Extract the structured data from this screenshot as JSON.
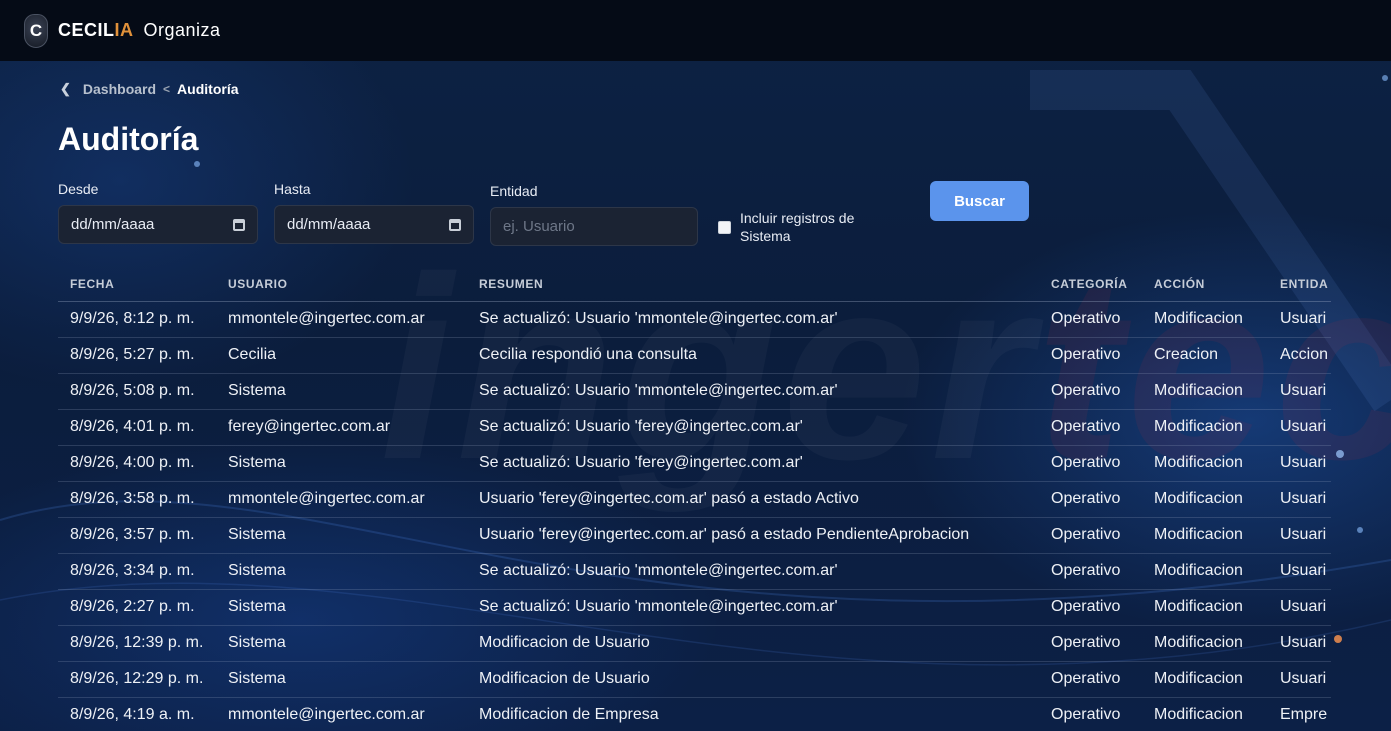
{
  "header": {
    "logo_letter": "C",
    "brand_main": "CECIL",
    "brand_accent": "IA",
    "brand_sub": "Organiza"
  },
  "breadcrumb": {
    "back_icon": "chevron-left-icon",
    "parent": "Dashboard",
    "separator": "<",
    "current": "Auditoría"
  },
  "page_title": "Auditoría",
  "filters": {
    "desde_label": "Desde",
    "desde_value": "dd/mm/aaaa",
    "hasta_label": "Hasta",
    "hasta_value": "dd/mm/aaaa",
    "entidad_label": "Entidad",
    "entidad_placeholder": "ej. Usuario",
    "include_system_label": "Incluir registros de Sistema",
    "include_system_checked": false,
    "search_button": "Buscar"
  },
  "table": {
    "columns": [
      "FECHA",
      "USUARIO",
      "RESUMEN",
      "CATEGORÍA",
      "ACCIÓN",
      "ENTIDA"
    ],
    "rows": [
      [
        "9/9/26, 8:12 p. m.",
        "mmontele@ingertec.com.ar",
        "Se actualizó: Usuario 'mmontele@ingertec.com.ar'",
        "Operativo",
        "Modificacion",
        "Usuari"
      ],
      [
        "8/9/26, 5:27 p. m.",
        "Cecilia",
        "Cecilia respondió una consulta",
        "Operativo",
        "Creacion",
        "Accion"
      ],
      [
        "8/9/26, 5:08 p. m.",
        "Sistema",
        "Se actualizó: Usuario 'mmontele@ingertec.com.ar'",
        "Operativo",
        "Modificacion",
        "Usuari"
      ],
      [
        "8/9/26, 4:01 p. m.",
        "ferey@ingertec.com.ar",
        "Se actualizó: Usuario 'ferey@ingertec.com.ar'",
        "Operativo",
        "Modificacion",
        "Usuari"
      ],
      [
        "8/9/26, 4:00 p. m.",
        "Sistema",
        "Se actualizó: Usuario 'ferey@ingertec.com.ar'",
        "Operativo",
        "Modificacion",
        "Usuari"
      ],
      [
        "8/9/26, 3:58 p. m.",
        "mmontele@ingertec.com.ar",
        "Usuario 'ferey@ingertec.com.ar' pasó a estado Activo",
        "Operativo",
        "Modificacion",
        "Usuari"
      ],
      [
        "8/9/26, 3:57 p. m.",
        "Sistema",
        "Usuario 'ferey@ingertec.com.ar' pasó a estado PendienteAprobacion",
        "Operativo",
        "Modificacion",
        "Usuari"
      ],
      [
        "8/9/26, 3:34 p. m.",
        "Sistema",
        "Se actualizó: Usuario 'mmontele@ingertec.com.ar'",
        "Operativo",
        "Modificacion",
        "Usuari"
      ],
      [
        "8/9/26, 2:27 p. m.",
        "Sistema",
        "Se actualizó: Usuario 'mmontele@ingertec.com.ar'",
        "Operativo",
        "Modificacion",
        "Usuari"
      ],
      [
        "8/9/26, 12:39 p. m.",
        "Sistema",
        "Modificacion de Usuario",
        "Operativo",
        "Modificacion",
        "Usuari"
      ],
      [
        "8/9/26, 12:29 p. m.",
        "Sistema",
        "Modificacion de Usuario",
        "Operativo",
        "Modificacion",
        "Usuari"
      ],
      [
        "8/9/26, 4:19 a. m.",
        "mmontele@ingertec.com.ar",
        "Modificacion de Empresa",
        "Operativo",
        "Modificacion",
        "Empre"
      ]
    ]
  },
  "colors": {
    "accent_orange": "#e0913a",
    "button_blue": "#5b94ec",
    "topbar": "#050b16"
  }
}
